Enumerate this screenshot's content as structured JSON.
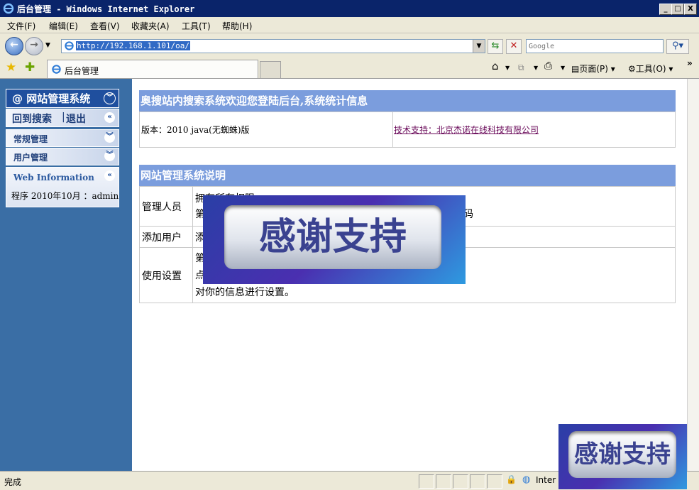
{
  "window": {
    "title": "后台管理 - Windows Internet Explorer",
    "min": "_",
    "max": "□",
    "close": "X"
  },
  "menu": [
    "文件(F)",
    "编辑(E)",
    "查看(V)",
    "收藏夹(A)",
    "工具(T)",
    "帮助(H)"
  ],
  "address": {
    "url": "http://192.168.1.101/oa/",
    "search_placeholder": "Google"
  },
  "tab": {
    "label": "后台管理"
  },
  "commands": {
    "page": "页面(P)",
    "tools": "工具(O)",
    "more": "»"
  },
  "sidebar": {
    "title": "@ 网站管理系统",
    "links": {
      "home": "回到搜索",
      "sep": "|",
      "logout": "退出"
    },
    "items": [
      {
        "label": "常规管理"
      },
      {
        "label": "用户管理"
      }
    ],
    "info": {
      "title": "Web Information",
      "text": "程序 2010年10月 ：admin"
    }
  },
  "main": {
    "welcome_header": "奥搜站内搜索系统欢迎您登陆后台,系统统计信息",
    "version": "版本：2010 java(无蜘蛛)版",
    "support": "技术支持：北京杰诺在线科技有限公司",
    "desc_header": "网站管理系统说明",
    "rows": [
      {
        "label": "管理人员",
        "lines": [
          "拥有所有权限",
          "第",
          "码"
        ]
      },
      {
        "label": "添加用户",
        "lines": [
          "添"
        ]
      },
      {
        "label": "使用设置",
        "lines": [
          "第",
          "点",
          "对你的信息进行设置。"
        ]
      }
    ]
  },
  "overlay": {
    "text": "感谢支持"
  },
  "status": {
    "text": "完成",
    "zone": "Inter"
  }
}
